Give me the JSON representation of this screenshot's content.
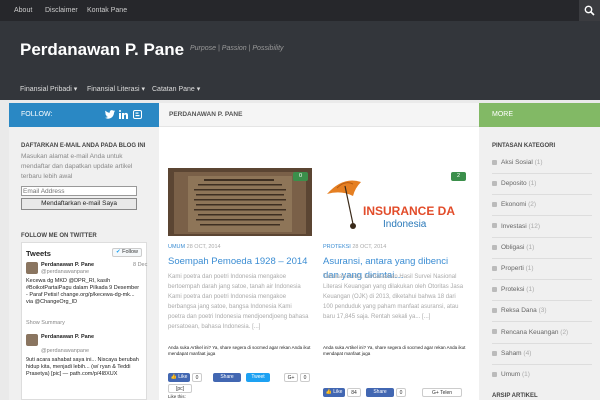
{
  "topnav": {
    "items": [
      "About",
      "Disclaimer",
      "Kontak Pane"
    ],
    "search_icon": "search-icon"
  },
  "site": {
    "title": "Perdanawan P. Pane",
    "tagline": "Purpose | Passion | Possibility"
  },
  "mainnav": {
    "items": [
      "Finansial Pribadi",
      "Finansial Literasi",
      "Catatan Pane"
    ]
  },
  "left": {
    "follow_label": "FOLLOW:",
    "social_icons": [
      "twitter-icon",
      "linkedin-icon",
      "blogger-icon"
    ],
    "subscribe_heading": "DAFTARKAN E-MAIL ANDA PADA BLOG INI",
    "subscribe_text": "Masukan alamat e-mail Anda untuk mendaftar dan dapatkan update artikel terbaru lebih awal",
    "email_placeholder": "Email Address",
    "subscribe_button": "Mendaftarkan e-mail Saya",
    "twitter_heading": "FOLLOW ME ON TWITTER",
    "twitter": {
      "title": "Tweets",
      "follow": "Follow",
      "tweets": [
        {
          "name": "Perdanawan P. Pane",
          "handle": "@perdanawanpane",
          "date": "8 Dec",
          "text": "Kecewa dg MKD @DPR_RI, kasih #BoikotPartaiPagu dalam Pilkada 9 Desember - Paraf Petisi! change.org/p/kecewa-dg-mk... via @ChangeOrg_ID",
          "summary": "Show Summary"
        },
        {
          "name": "Perdanawan P. Pane",
          "handle": "@perdanawanpane",
          "date": "",
          "text": "9uti acara sahabat saya ini... Niscaya berubah hidup kita, menjadi lebih... (w/ ryan & Teddi Prasetya) [pic] — path.com/p/4I8XUX"
        }
      ]
    }
  },
  "main": {
    "header": "PERDANAWAN P. PANE",
    "posts": [
      {
        "comments": "0",
        "category": "UMUM",
        "date": "28 OCT, 2014",
        "title": "Soempah Pemoeda 1928 – 2014",
        "excerpt": "Kami poetra dan poetri Indonesia mengakoe bertoempah darah jang satoe, tanah air Indonesia Kami poetra dan poetri Indonesia mengakoe berbangsa jang satoe, bangsa Indonesia Kami poetra dan poetri Indonesia mendjoendjoeng bahasa persatoean, bahasa Indonesia. [...]",
        "share_question": "Anda suka Artikel ini? Ya, share segera di socmed agar rekan Anda ikut mendapat manfaat juga",
        "like": "Like",
        "share_count": "0",
        "share": "Share",
        "tweet": "Tweet",
        "g1_count": "0"
      },
      {
        "comments": "2",
        "category": "PROTEKSI",
        "date": "28 OCT, 2014",
        "title": "Asuransi, antara yang dibenci dan yang dicintai…",
        "thumb_text_1": "INSURANCE DA",
        "thumb_text_2": "Indonesia",
        "excerpt": "Tahukah Anda, berdasarkan Hasil Survei Nasional Literasi Keuangan yang dilakukan oleh Otoritas Jasa Keuangan (OJK) di 2013, diketahui bahwa 18 dari 100 penduduk yang paham manfaat asuransi, atau baru 17,845 saja. Rentah sekali ya... [...]",
        "share_question": "Anda suka Artikel ini? Ya, share segera di socmed agar rekan Anda ikut mendapat manfaat juga",
        "like": "Like",
        "like_count": "84",
        "share": "Share",
        "share_count": "0",
        "tweet": "Tweet",
        "g1_count": "0",
        "g1_label": "Telen"
      }
    ],
    "like_this": "Like this:"
  },
  "right": {
    "more_label": "MORE",
    "categories_heading": "PINTASAN KATEGORI",
    "categories": [
      {
        "name": "Aksi Sosial",
        "count": "(1)"
      },
      {
        "name": "Deposito",
        "count": "(1)"
      },
      {
        "name": "Ekonomi",
        "count": "(2)"
      },
      {
        "name": "Investasi",
        "count": "(12)"
      },
      {
        "name": "Obligasi",
        "count": "(1)"
      },
      {
        "name": "Properti",
        "count": "(1)"
      },
      {
        "name": "Proteksi",
        "count": "(1)"
      },
      {
        "name": "Reksa Dana",
        "count": "(3)"
      },
      {
        "name": "Rencana Keuangan",
        "count": "(2)"
      },
      {
        "name": "Saham",
        "count": "(4)"
      },
      {
        "name": "Umum",
        "count": "(1)"
      }
    ],
    "archive_heading": "ARSIP ARTIKEL"
  }
}
